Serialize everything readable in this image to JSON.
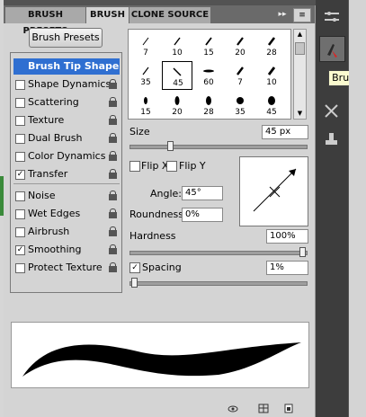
{
  "tabs": [
    {
      "label": "BRUSH PRESETS"
    },
    {
      "label": "BRUSH"
    },
    {
      "label": "CLONE SOURCE"
    }
  ],
  "panel_fwd": "▸▸",
  "panel_menu": "≡",
  "brush_presets_button": "Brush Presets",
  "options": [
    {
      "label": "Brush Tip Shape",
      "checked": false,
      "selected": true
    },
    {
      "label": "Shape Dynamics",
      "checked": false
    },
    {
      "label": "Scattering",
      "checked": false
    },
    {
      "label": "Texture",
      "checked": false
    },
    {
      "label": "Dual Brush",
      "checked": false
    },
    {
      "label": "Color Dynamics",
      "checked": false
    },
    {
      "label": "Transfer",
      "checked": true
    },
    {
      "label": "Noise",
      "checked": false
    },
    {
      "label": "Wet Edges",
      "checked": false
    },
    {
      "label": "Airbrush",
      "checked": false
    },
    {
      "label": "Smoothing",
      "checked": true
    },
    {
      "label": "Protect Texture",
      "checked": false
    }
  ],
  "brush_grid": [
    {
      "size": "7"
    },
    {
      "size": "10"
    },
    {
      "size": "15"
    },
    {
      "size": "20"
    },
    {
      "size": "28"
    },
    {
      "size": "35"
    },
    {
      "size": "45"
    },
    {
      "size": "60"
    },
    {
      "size": "7"
    },
    {
      "size": "10"
    },
    {
      "size": "15"
    },
    {
      "size": "20"
    },
    {
      "size": "28"
    },
    {
      "size": "35"
    },
    {
      "size": "45"
    }
  ],
  "size": {
    "label": "Size",
    "value": "45 px",
    "slider_fraction": 0.22
  },
  "flip_x": {
    "label": "Flip X",
    "checked": false
  },
  "flip_y": {
    "label": "Flip Y",
    "checked": false
  },
  "angle": {
    "label": "Angle:",
    "value": "45°"
  },
  "roundness": {
    "label": "Roundness:",
    "value": "0%"
  },
  "hardness": {
    "label": "Hardness",
    "value": "100%",
    "slider_fraction": 1.0
  },
  "spacing": {
    "label": "Spacing",
    "value": "1%",
    "checked": true,
    "slider_fraction": 0.01
  },
  "tooltip": "Brush",
  "dock_icons": [
    "brush-sliders-icon",
    "brush-panel-icon",
    "tools-icon",
    "stamp-icon"
  ]
}
